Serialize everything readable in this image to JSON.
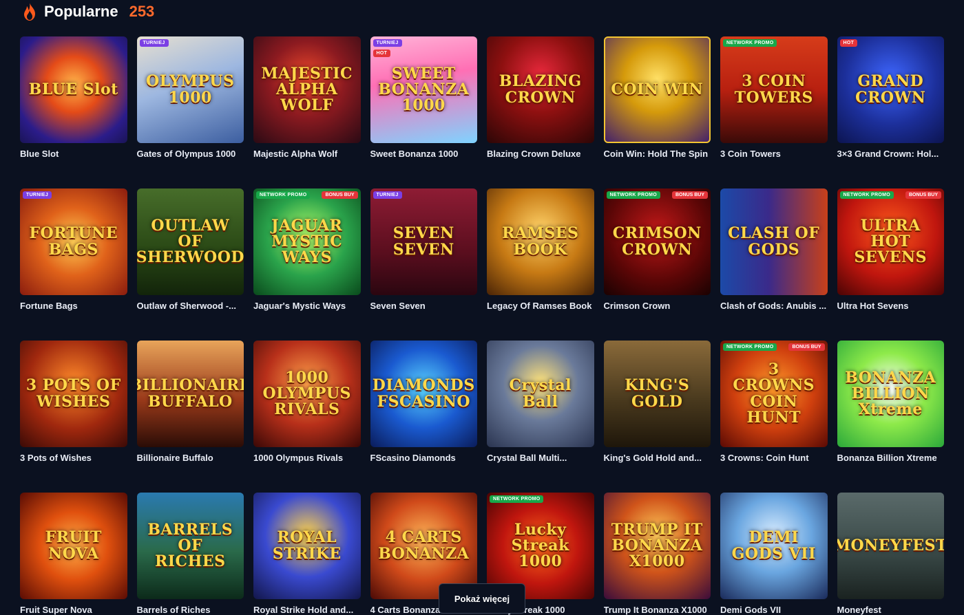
{
  "section": {
    "title": "Popularne",
    "count": "253"
  },
  "games": [
    {
      "name": "Blue Slot",
      "art": "BLUE Slot",
      "badges": [],
      "bonus": ""
    },
    {
      "name": "Gates of Olympus 1000",
      "art": "OLYMPUS 1000",
      "badges": [
        "TURNIEJ"
      ],
      "bonus": ""
    },
    {
      "name": "Majestic Alpha Wolf",
      "art": "MAJESTIC ALPHA WOLF",
      "badges": [],
      "bonus": ""
    },
    {
      "name": "Sweet Bonanza 1000",
      "art": "SWEET BONANZA 1000",
      "badges": [
        "TURNIEJ",
        "HOT"
      ],
      "bonus": ""
    },
    {
      "name": "Blazing Crown Deluxe",
      "art": "BLAZING CROWN",
      "badges": [],
      "bonus": ""
    },
    {
      "name": "Coin Win: Hold The Spin",
      "art": "COIN WIN",
      "badges": [],
      "bonus": ""
    },
    {
      "name": "3 Coin Towers",
      "art": "3 COIN TOWERS",
      "badges": [
        "NETWORK PROMO"
      ],
      "bonus": ""
    },
    {
      "name": "3×3 Grand Crown: Hol...",
      "art": "GRAND CROWN",
      "badges": [
        "HOT"
      ],
      "bonus": ""
    },
    {
      "name": "Fortune Bags",
      "art": "FORTUNE BAGS",
      "badges": [
        "TURNIEJ"
      ],
      "bonus": ""
    },
    {
      "name": "Outlaw of Sherwood -...",
      "art": "OUTLAW OF SHERWOOD",
      "badges": [],
      "bonus": ""
    },
    {
      "name": "Jaguar's Mystic Ways",
      "art": "JAGUAR MYSTIC WAYS",
      "badges": [
        "NETWORK PROMO"
      ],
      "bonus": "BONUS BUY"
    },
    {
      "name": "Seven Seven",
      "art": "SEVEN SEVEN",
      "badges": [
        "TURNIEJ"
      ],
      "bonus": ""
    },
    {
      "name": "Legacy Of Ramses Book",
      "art": "RAMSES BOOK",
      "badges": [],
      "bonus": ""
    },
    {
      "name": "Crimson Crown",
      "art": "CRIMSON CROWN",
      "badges": [
        "NETWORK PROMO"
      ],
      "bonus": "BONUS BUY"
    },
    {
      "name": "Clash of Gods: Anubis ...",
      "art": "CLASH OF GODS",
      "badges": [],
      "bonus": ""
    },
    {
      "name": "Ultra Hot Sevens",
      "art": "ULTRA HOT SEVENS",
      "badges": [
        "NETWORK PROMO"
      ],
      "bonus": "BONUS BUY"
    },
    {
      "name": "3 Pots of Wishes",
      "art": "3 POTS OF WISHES",
      "badges": [],
      "bonus": ""
    },
    {
      "name": "Billionaire Buffalo",
      "art": "BILLIONAIRE BUFFALO",
      "badges": [],
      "bonus": ""
    },
    {
      "name": "1000 Olympus Rivals",
      "art": "1000 OLYMPUS RIVALS",
      "badges": [],
      "bonus": ""
    },
    {
      "name": "FScasino Diamonds",
      "art": "DIAMONDS FSCASINO",
      "badges": [],
      "bonus": ""
    },
    {
      "name": "Crystal Ball Multi...",
      "art": "Crystal Ball",
      "badges": [],
      "bonus": ""
    },
    {
      "name": "King's Gold Hold and...",
      "art": "KING'S GOLD",
      "badges": [],
      "bonus": ""
    },
    {
      "name": "3 Crowns: Coin Hunt",
      "art": "3 CROWNS COIN HUNT",
      "badges": [
        "NETWORK PROMO"
      ],
      "bonus": "BONUS BUY"
    },
    {
      "name": "Bonanza Billion Xtreme",
      "art": "BONANZA BILLION Xtreme",
      "badges": [],
      "bonus": ""
    },
    {
      "name": "Fruit Super Nova",
      "art": "FRUIT NOVA",
      "badges": [],
      "bonus": ""
    },
    {
      "name": "Barrels of Riches",
      "art": "BARRELS OF RICHES",
      "badges": [],
      "bonus": ""
    },
    {
      "name": "Royal Strike Hold and...",
      "art": "ROYAL STRIKE",
      "badges": [],
      "bonus": ""
    },
    {
      "name": "4 Carts Bonanza:...",
      "art": "4 CARTS BONANZA",
      "badges": [],
      "bonus": ""
    },
    {
      "name": "Lucky Streak 1000",
      "art": "Lucky Streak 1000",
      "badges": [
        "NETWORK PROMO"
      ],
      "bonus": ""
    },
    {
      "name": "Trump It Bonanza X1000",
      "art": "TRUMP IT BONANZA X1000",
      "badges": [],
      "bonus": ""
    },
    {
      "name": "Demi Gods VII",
      "art": "DEMI GODS VII",
      "badges": [],
      "bonus": ""
    },
    {
      "name": "Moneyfest",
      "art": "MONEYFEST",
      "badges": [],
      "bonus": ""
    }
  ],
  "show_more_label": "Pokaż więcej",
  "colors": {
    "background": "#0b1120",
    "accent": "#ff6a2c",
    "badge_turniej": "#7b3fe4",
    "badge_hot": "#e5343a",
    "badge_network": "#18a84a"
  },
  "icons": {
    "header": "flame-icon"
  }
}
